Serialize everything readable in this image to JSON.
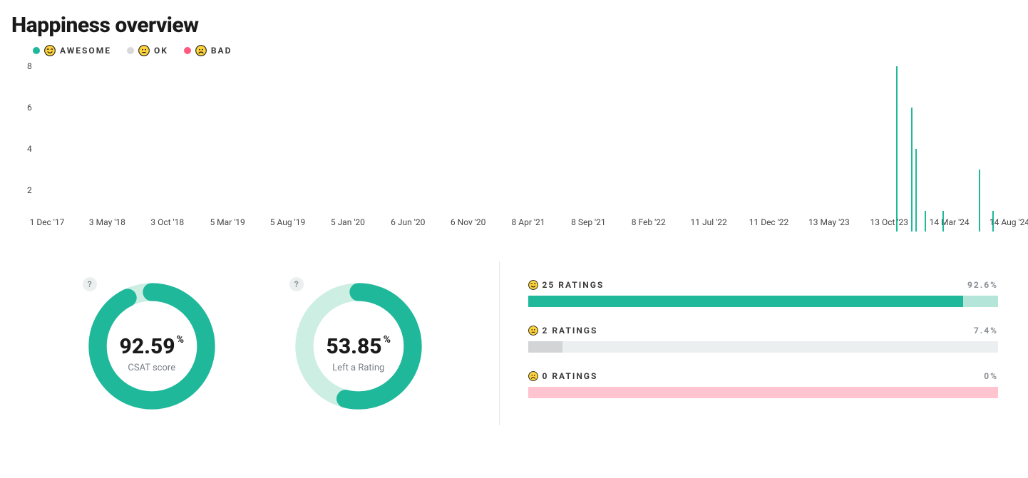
{
  "title": "Happiness overview",
  "legend": {
    "awesome": "AWESOME",
    "ok": "OK",
    "bad": "BAD"
  },
  "colors": {
    "awesome": "#1fb89a",
    "ok": "#d9d9d9",
    "bad": "#ff5a7d"
  },
  "donuts": {
    "csat": {
      "value": "92.59",
      "unit": "%",
      "label": "CSAT score",
      "percent": 92.59
    },
    "rated": {
      "value": "53.85",
      "unit": "%",
      "label": "Left a Rating",
      "percent": 53.85
    }
  },
  "ratings": {
    "awesome": {
      "count_label": "25 RATINGS",
      "pct_label": "92.6%",
      "pct": 92.6
    },
    "ok": {
      "count_label": "2 RATINGS",
      "pct_label": "7.4%",
      "pct": 7.4
    },
    "bad": {
      "count_label": "0 RATINGS",
      "pct_label": "0%",
      "pct": 0
    }
  },
  "chart_data": {
    "type": "bar",
    "title": "Happiness overview",
    "xlabel": "",
    "ylabel": "",
    "ylim": [
      0,
      8
    ],
    "y_ticks": [
      2,
      4,
      6,
      8
    ],
    "x_ticks": [
      "1 Dec '17",
      "3 May '18",
      "3 Oct '18",
      "5 Mar '19",
      "5 Aug '19",
      "5 Jan '20",
      "6 Jun '20",
      "6 Nov '20",
      "8 Apr '21",
      "8 Sep '21",
      "8 Feb '22",
      "11 Jul '22",
      "11 Dec '22",
      "13 May '23",
      "13 Oct '23",
      "14 Mar '24",
      "14 Aug '24"
    ],
    "series": [
      {
        "name": "AWESOME",
        "color": "#1fb89a",
        "bars": [
          {
            "x_frac": 0.882,
            "value": 8
          },
          {
            "x_frac": 0.898,
            "value": 6
          },
          {
            "x_frac": 0.902,
            "value": 4
          },
          {
            "x_frac": 0.912,
            "value": 1
          },
          {
            "x_frac": 0.93,
            "value": 1
          },
          {
            "x_frac": 0.968,
            "value": 3
          },
          {
            "x_frac": 0.982,
            "value": 1
          }
        ]
      }
    ]
  }
}
